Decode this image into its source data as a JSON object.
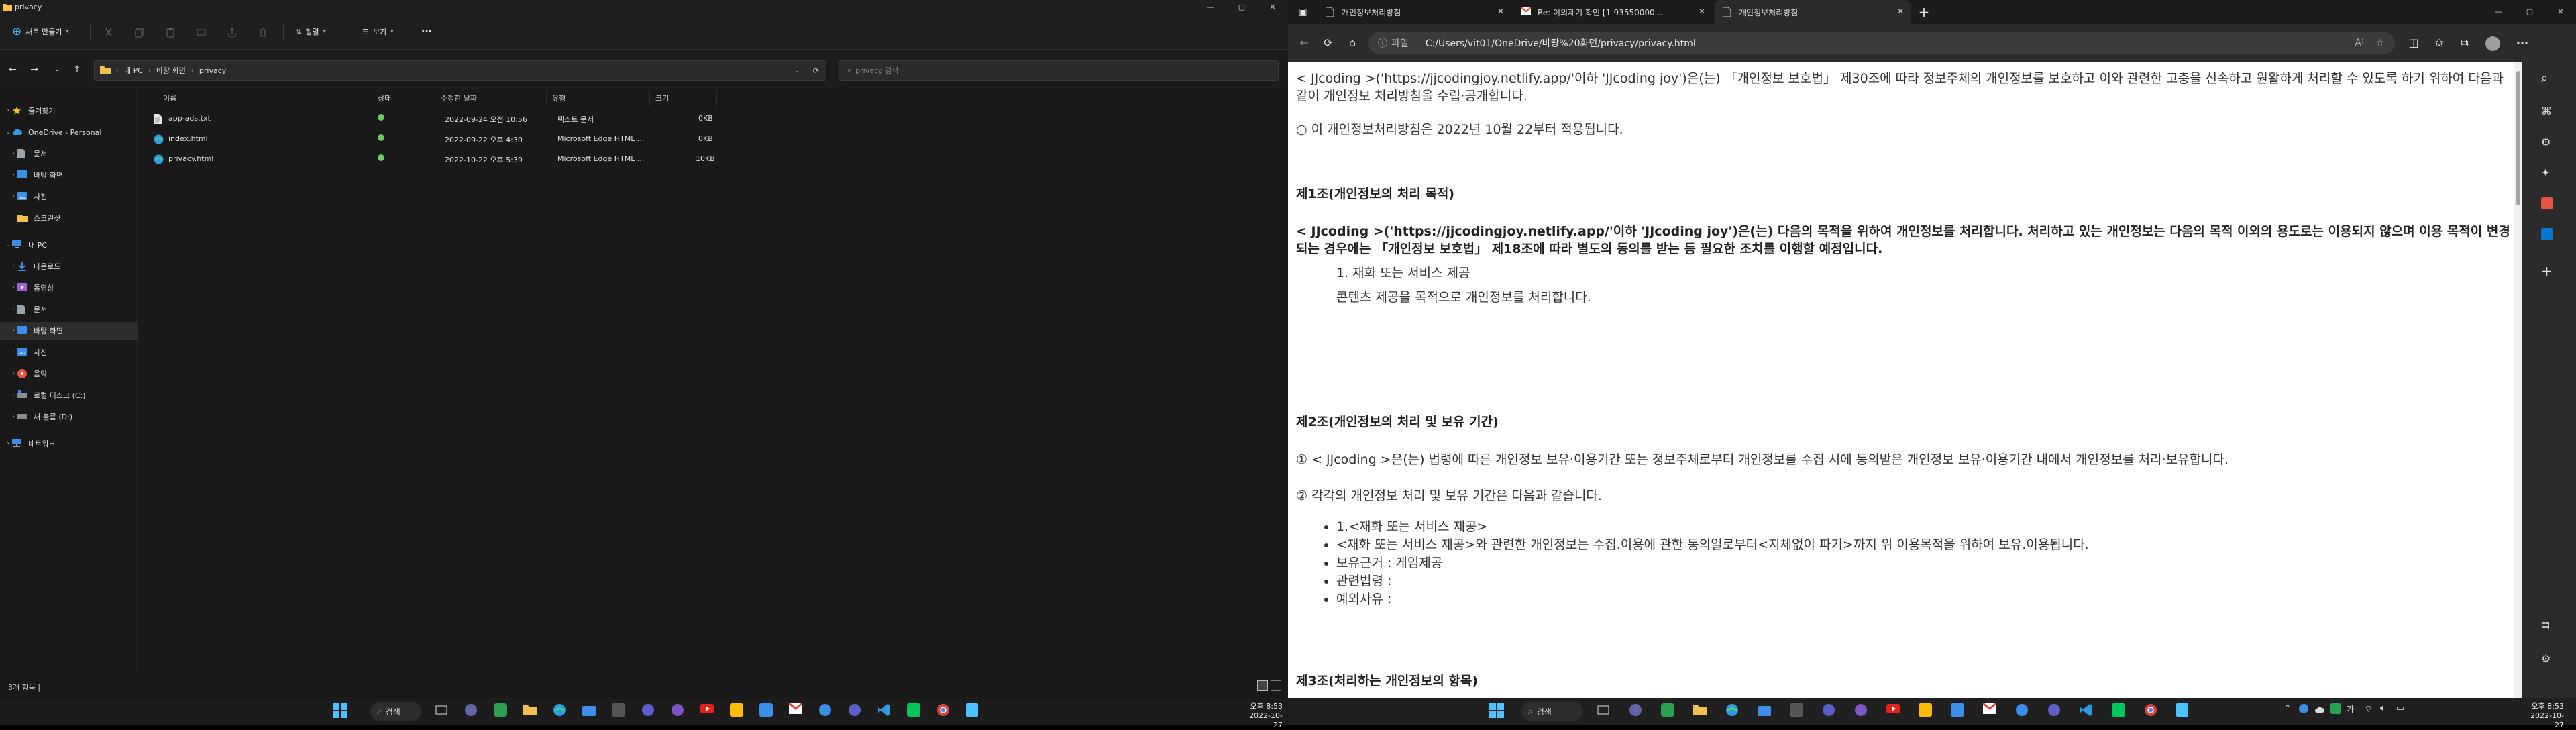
{
  "explorer": {
    "window_title": "privacy",
    "toolbar": {
      "new_label": "새로 만들기",
      "sort_label": "정렬",
      "view_label": "보기",
      "more_label": "···"
    },
    "address": {
      "crumbs": [
        "내 PC",
        "바탕 화면",
        "privacy"
      ]
    },
    "search_placeholder": "privacy 검색",
    "sidebar": {
      "items": [
        {
          "label": "즐겨찾기",
          "icon": "star-icon",
          "color": "#f5c518"
        },
        {
          "label": "OneDrive - Personal",
          "icon": "cloud-icon",
          "color": "#3a96dd"
        },
        {
          "label": "문서",
          "icon": "document-icon",
          "color": "#9aa4ad"
        },
        {
          "label": "바탕 화면",
          "icon": "desktop-icon",
          "color": "#3d8ee8"
        },
        {
          "label": "사진",
          "icon": "photo-icon",
          "color": "#3d8ee8"
        },
        {
          "label": "스크린샷",
          "icon": "folder-icon",
          "color": "#f2c14e"
        },
        {
          "label": "내 PC",
          "icon": "pc-icon",
          "color": "#3d8ee8"
        },
        {
          "label": "다운로드",
          "icon": "download-icon",
          "color": "#3d8ee8"
        },
        {
          "label": "동영상",
          "icon": "video-icon",
          "color": "#9a62d4"
        },
        {
          "label": "문서",
          "icon": "document-icon",
          "color": "#9aa4ad"
        },
        {
          "label": "바탕 화면",
          "icon": "desktop-icon",
          "color": "#3d8ee8"
        },
        {
          "label": "사진",
          "icon": "photo-icon",
          "color": "#3d8ee8"
        },
        {
          "label": "음악",
          "icon": "music-icon",
          "color": "#e8533f"
        },
        {
          "label": "로컬 디스크 (C:)",
          "icon": "disk-icon",
          "color": "#8c8c8c"
        },
        {
          "label": "새 볼륨 (D:)",
          "icon": "disk-icon",
          "color": "#8c8c8c"
        },
        {
          "label": "네트워크",
          "icon": "network-icon",
          "color": "#3d8ee8"
        }
      ]
    },
    "columns": [
      "이름",
      "상태",
      "수정한 날짜",
      "유형",
      "크기"
    ],
    "files": [
      {
        "name": "app-ads.txt",
        "modified": "2022-09-24 오전 10:56",
        "type": "텍스트 문서",
        "size": "0KB",
        "icon": "text-file-icon"
      },
      {
        "name": "index.html",
        "modified": "2022-09-22 오후 4:30",
        "type": "Microsoft Edge HTML ...",
        "size": "0KB",
        "icon": "edge-html-file-icon"
      },
      {
        "name": "privacy.html",
        "modified": "2022-10-22 오후 5:39",
        "type": "Microsoft Edge HTML ...",
        "size": "10KB",
        "icon": "edge-html-file-icon"
      }
    ],
    "status_text": "3개 항목  |"
  },
  "edge": {
    "tabs": [
      {
        "title": "개인정보처리방침",
        "favicon": "page-icon",
        "active": false
      },
      {
        "title": "Re: 이의제기 확인 [1-93550000...",
        "favicon": "gmail-icon",
        "active": false
      },
      {
        "title": "개인정보처리방침",
        "favicon": "page-icon",
        "active": true
      }
    ],
    "url_scheme": "파일",
    "url": "C:/Users/vit01/OneDrive/바탕%20화면/privacy/privacy.html",
    "page": {
      "intro_1": "< JJcoding >('https://jjcodingjoy.netlify.app/'이하 'JJcoding joy')은(는) 「개인정보 보호법」 제30조에 따라 정보주체의 개인정보를 보호하고 이와 관련한 고충을 신속하고 원활하게 처리할 수 있도록 하기 위하여 다음과 같이 개인정보 처리방침을 수립·공개합니다.",
      "intro_2": "○ 이 개인정보처리방침은 2022년 10월 22부터 적용됩니다.",
      "art1_title": "제1조(개인정보의 처리 목적)",
      "art1_body": "< JJcoding >('https://jjcodingjoy.netlify.app/'이하 'JJcoding joy')은(는) 다음의 목적을 위하여 개인정보를 처리합니다. 처리하고 있는 개인정보는 다음의 목적 이외의 용도로는 이용되지 않으며 이용 목적이 변경되는 경우에는 「개인정보 보호법」 제18조에 따라 별도의 동의를 받는 등 필요한 조치를 이행할 예정입니다.",
      "art1_item": "1. 재화 또는 서비스 제공",
      "art1_item_desc": "콘텐츠 제공을 목적으로 개인정보를 처리합니다.",
      "art2_title": "제2조(개인정보의 처리 및 보유 기간)",
      "art2_p1": "① < JJcoding >은(는) 법령에 따른 개인정보 보유·이용기간 또는 정보주체로부터 개인정보를 수집 시에 동의받은 개인정보 보유·이용기간 내에서 개인정보를 처리·보유합니다.",
      "art2_p2": "② 각각의 개인정보 처리 및 보유 기간은 다음과 같습니다.",
      "art2_list": [
        "1.<재화 또는 서비스 제공>",
        "<재화 또는 서비스 제공>와 관련한 개인정보는 수집.이용에 관한 동의일로부터<지체없이 파기>까지 위 이용목적을 위하여 보유.이용됩니다.",
        "보유근거 : 게임제공",
        "관련법령 :",
        "예외사유 :"
      ],
      "art3_title": "제3조(처리하는 개인정보의 항목)"
    }
  },
  "taskbar_left": {
    "search_label": "검색",
    "time": "오후 8:53",
    "date": "2022-10-27"
  },
  "taskbar_right": {
    "search_label": "검색",
    "time": "오후 8:53",
    "date": "2022-10-27"
  }
}
